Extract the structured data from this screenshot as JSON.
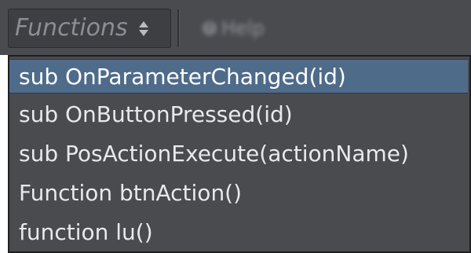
{
  "toolbar": {
    "functions_label": "Functions",
    "help_label": "Help",
    "help_icon_glyph": "?"
  },
  "colors": {
    "toolbar_bg": "#4a4b4f",
    "selection_bg": "#4f6b8a",
    "text": "#e8e9eb"
  },
  "icons": {
    "sort_indicator": "updown-arrows-icon",
    "help": "help-circle-icon"
  },
  "dropdown": {
    "selected_index": 0,
    "items": [
      {
        "label": "sub OnParameterChanged(id)"
      },
      {
        "label": "sub OnButtonPressed(id)"
      },
      {
        "label": "sub PosActionExecute(actionName)"
      },
      {
        "label": "Function btnAction()"
      },
      {
        "label": "function lu()"
      }
    ]
  }
}
